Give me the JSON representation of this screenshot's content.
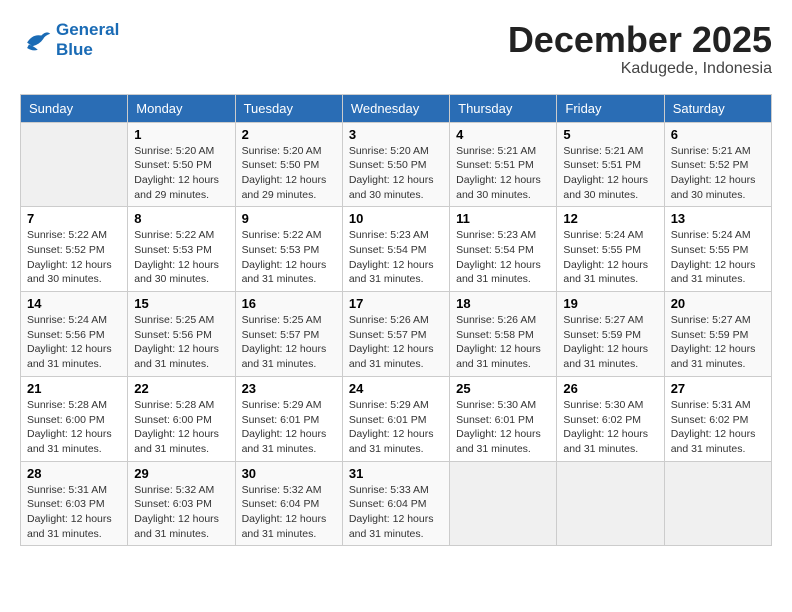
{
  "header": {
    "logo_line1": "General",
    "logo_line2": "Blue",
    "month": "December 2025",
    "location": "Kadugede, Indonesia"
  },
  "weekdays": [
    "Sunday",
    "Monday",
    "Tuesday",
    "Wednesday",
    "Thursday",
    "Friday",
    "Saturday"
  ],
  "weeks": [
    [
      {
        "day": "",
        "info": ""
      },
      {
        "day": "1",
        "info": "Sunrise: 5:20 AM\nSunset: 5:50 PM\nDaylight: 12 hours\nand 29 minutes."
      },
      {
        "day": "2",
        "info": "Sunrise: 5:20 AM\nSunset: 5:50 PM\nDaylight: 12 hours\nand 29 minutes."
      },
      {
        "day": "3",
        "info": "Sunrise: 5:20 AM\nSunset: 5:50 PM\nDaylight: 12 hours\nand 30 minutes."
      },
      {
        "day": "4",
        "info": "Sunrise: 5:21 AM\nSunset: 5:51 PM\nDaylight: 12 hours\nand 30 minutes."
      },
      {
        "day": "5",
        "info": "Sunrise: 5:21 AM\nSunset: 5:51 PM\nDaylight: 12 hours\nand 30 minutes."
      },
      {
        "day": "6",
        "info": "Sunrise: 5:21 AM\nSunset: 5:52 PM\nDaylight: 12 hours\nand 30 minutes."
      }
    ],
    [
      {
        "day": "7",
        "info": "Sunrise: 5:22 AM\nSunset: 5:52 PM\nDaylight: 12 hours\nand 30 minutes."
      },
      {
        "day": "8",
        "info": "Sunrise: 5:22 AM\nSunset: 5:53 PM\nDaylight: 12 hours\nand 30 minutes."
      },
      {
        "day": "9",
        "info": "Sunrise: 5:22 AM\nSunset: 5:53 PM\nDaylight: 12 hours\nand 31 minutes."
      },
      {
        "day": "10",
        "info": "Sunrise: 5:23 AM\nSunset: 5:54 PM\nDaylight: 12 hours\nand 31 minutes."
      },
      {
        "day": "11",
        "info": "Sunrise: 5:23 AM\nSunset: 5:54 PM\nDaylight: 12 hours\nand 31 minutes."
      },
      {
        "day": "12",
        "info": "Sunrise: 5:24 AM\nSunset: 5:55 PM\nDaylight: 12 hours\nand 31 minutes."
      },
      {
        "day": "13",
        "info": "Sunrise: 5:24 AM\nSunset: 5:55 PM\nDaylight: 12 hours\nand 31 minutes."
      }
    ],
    [
      {
        "day": "14",
        "info": "Sunrise: 5:24 AM\nSunset: 5:56 PM\nDaylight: 12 hours\nand 31 minutes."
      },
      {
        "day": "15",
        "info": "Sunrise: 5:25 AM\nSunset: 5:56 PM\nDaylight: 12 hours\nand 31 minutes."
      },
      {
        "day": "16",
        "info": "Sunrise: 5:25 AM\nSunset: 5:57 PM\nDaylight: 12 hours\nand 31 minutes."
      },
      {
        "day": "17",
        "info": "Sunrise: 5:26 AM\nSunset: 5:57 PM\nDaylight: 12 hours\nand 31 minutes."
      },
      {
        "day": "18",
        "info": "Sunrise: 5:26 AM\nSunset: 5:58 PM\nDaylight: 12 hours\nand 31 minutes."
      },
      {
        "day": "19",
        "info": "Sunrise: 5:27 AM\nSunset: 5:59 PM\nDaylight: 12 hours\nand 31 minutes."
      },
      {
        "day": "20",
        "info": "Sunrise: 5:27 AM\nSunset: 5:59 PM\nDaylight: 12 hours\nand 31 minutes."
      }
    ],
    [
      {
        "day": "21",
        "info": "Sunrise: 5:28 AM\nSunset: 6:00 PM\nDaylight: 12 hours\nand 31 minutes."
      },
      {
        "day": "22",
        "info": "Sunrise: 5:28 AM\nSunset: 6:00 PM\nDaylight: 12 hours\nand 31 minutes."
      },
      {
        "day": "23",
        "info": "Sunrise: 5:29 AM\nSunset: 6:01 PM\nDaylight: 12 hours\nand 31 minutes."
      },
      {
        "day": "24",
        "info": "Sunrise: 5:29 AM\nSunset: 6:01 PM\nDaylight: 12 hours\nand 31 minutes."
      },
      {
        "day": "25",
        "info": "Sunrise: 5:30 AM\nSunset: 6:01 PM\nDaylight: 12 hours\nand 31 minutes."
      },
      {
        "day": "26",
        "info": "Sunrise: 5:30 AM\nSunset: 6:02 PM\nDaylight: 12 hours\nand 31 minutes."
      },
      {
        "day": "27",
        "info": "Sunrise: 5:31 AM\nSunset: 6:02 PM\nDaylight: 12 hours\nand 31 minutes."
      }
    ],
    [
      {
        "day": "28",
        "info": "Sunrise: 5:31 AM\nSunset: 6:03 PM\nDaylight: 12 hours\nand 31 minutes."
      },
      {
        "day": "29",
        "info": "Sunrise: 5:32 AM\nSunset: 6:03 PM\nDaylight: 12 hours\nand 31 minutes."
      },
      {
        "day": "30",
        "info": "Sunrise: 5:32 AM\nSunset: 6:04 PM\nDaylight: 12 hours\nand 31 minutes."
      },
      {
        "day": "31",
        "info": "Sunrise: 5:33 AM\nSunset: 6:04 PM\nDaylight: 12 hours\nand 31 minutes."
      },
      {
        "day": "",
        "info": ""
      },
      {
        "day": "",
        "info": ""
      },
      {
        "day": "",
        "info": ""
      }
    ]
  ]
}
